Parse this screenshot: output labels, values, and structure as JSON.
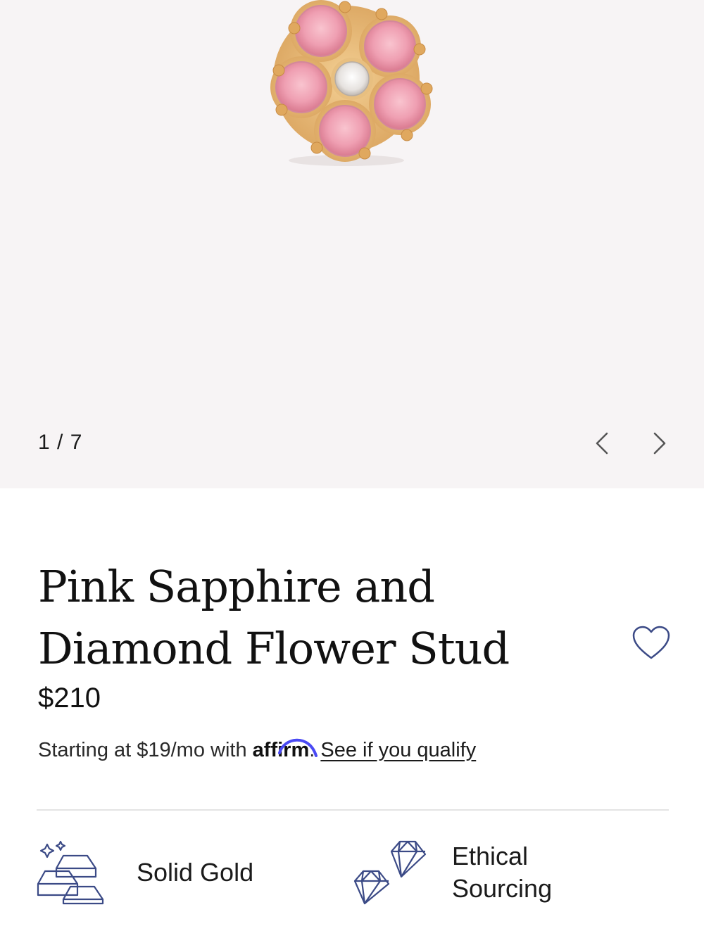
{
  "gallery": {
    "counter": "1 / 7",
    "prev_icon": "chevron-left-icon",
    "next_icon": "chevron-right-icon",
    "background": "#f7f4f5"
  },
  "product": {
    "title": "Pink Sapphire and Diamond Flower Stud",
    "price": "$210",
    "favorite_icon": "heart-icon"
  },
  "financing": {
    "prefix": "Starting at $19/mo with",
    "brand": "affirm",
    "period": ".",
    "link": "See if you qualify",
    "brand_accent": "#4a4af4"
  },
  "features": [
    {
      "label": "Solid Gold",
      "icon": "gold-bars-icon"
    },
    {
      "label": "Ethical Sourcing",
      "icon": "diamonds-icon"
    }
  ],
  "colors": {
    "icon_stroke": "#3b4a86",
    "sapphire": "#f2a6b6",
    "gold": "#e2b36e"
  }
}
